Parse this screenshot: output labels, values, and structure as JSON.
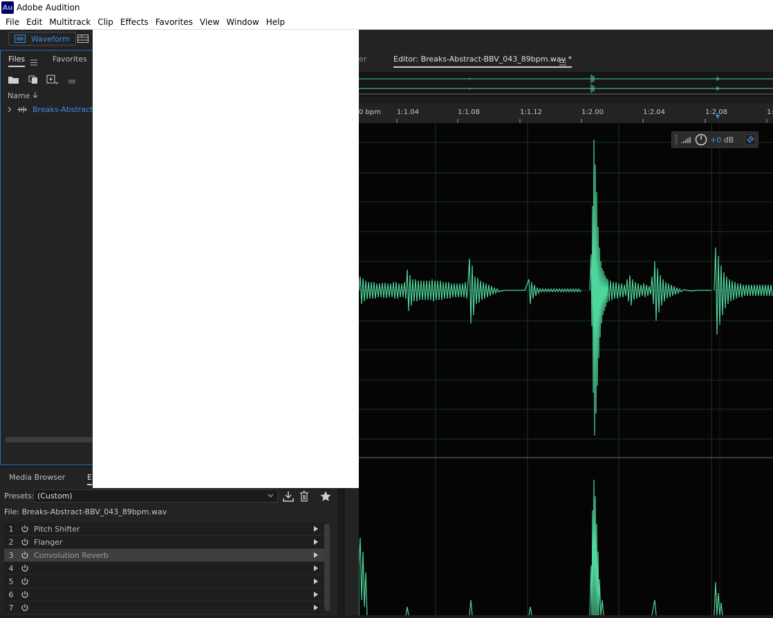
{
  "titlebar": {
    "logo": "Au",
    "title": "Adobe Audition"
  },
  "menubar": {
    "items": [
      "File",
      "Edit",
      "Multitrack",
      "Clip",
      "Effects",
      "Favorites",
      "View",
      "Window",
      "Help"
    ]
  },
  "toolbar": {
    "waveform_label": "Waveform"
  },
  "files_panel": {
    "tabs": [
      "Files",
      "Favorites"
    ],
    "column_name": "Name",
    "file_item": "Breaks-Abstract"
  },
  "editor": {
    "prev_tab_partial": "er",
    "tab_title": "Editor: Breaks-Abstract-BBV_043_89bpm.wav *",
    "ruler_labels": [
      "0 bpm",
      "1:1.04",
      "1:1.08",
      "1:1.12",
      "1:2.00",
      "1:2.04",
      "1:2.08",
      "1:"
    ],
    "hud_gain": "+0",
    "hud_unit": "dB"
  },
  "effects_rack": {
    "tabs": [
      "Media Browser",
      "E"
    ],
    "presets_label": "Presets:",
    "presets_value": "(Custom)",
    "file_label": "File: Breaks-Abstract-BBV_043_89bpm.wav",
    "slots": [
      {
        "num": "1",
        "name": "Pitch Shifter"
      },
      {
        "num": "2",
        "name": "Flanger"
      },
      {
        "num": "3",
        "name": "Convolution Reverb"
      },
      {
        "num": "4",
        "name": ""
      },
      {
        "num": "5",
        "name": ""
      },
      {
        "num": "6",
        "name": ""
      },
      {
        "num": "7",
        "name": ""
      }
    ],
    "selected_slot": 3
  },
  "colors": {
    "accent": "#3d8ee8",
    "wave": "#4fd69c",
    "grid": "#1d4a2a"
  }
}
